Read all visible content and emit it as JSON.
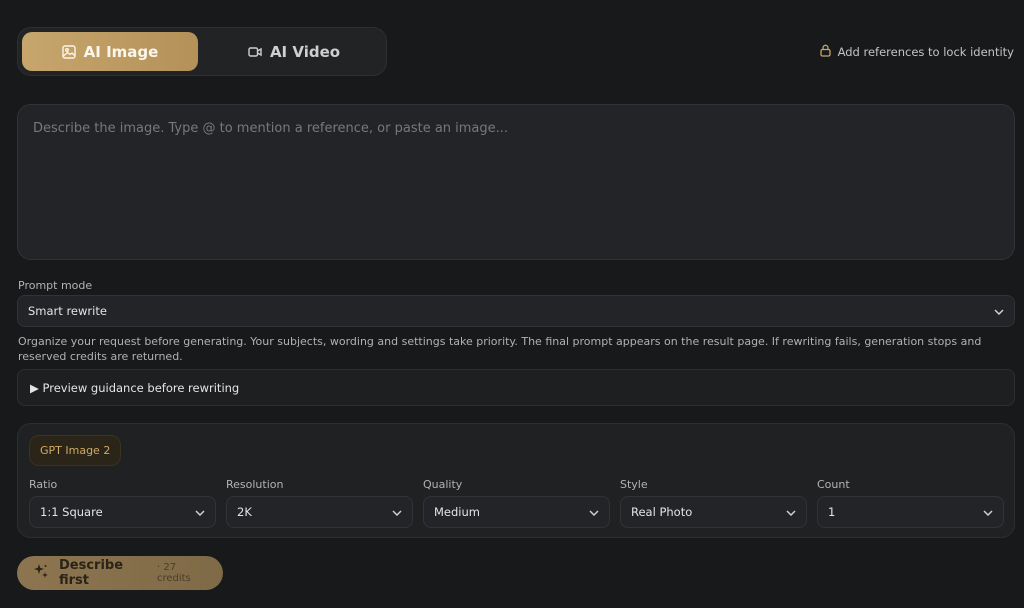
{
  "mode_switch": {
    "tabs": [
      {
        "label": "AI Image",
        "icon": "image-icon",
        "active": true
      },
      {
        "label": "AI Video",
        "icon": "video-icon",
        "active": false
      }
    ]
  },
  "lock_hint": {
    "label": "Add references to lock identity",
    "icon": "lock-icon"
  },
  "prompt": {
    "value": "",
    "placeholder": "Describe the image. Type @ to mention a reference, or paste an image..."
  },
  "prompt_mode": {
    "label": "Prompt mode",
    "value": "Smart rewrite",
    "helper": "Organize your request before generating. Your subjects, wording and settings take priority. The final prompt appears on the result page. If rewriting fails, generation stops and reserved credits are returned."
  },
  "preview": {
    "label": "▶ Preview guidance before rewriting"
  },
  "settings": {
    "model": "GPT Image 2",
    "fields": [
      {
        "label": "Ratio",
        "value": "1:1 Square"
      },
      {
        "label": "Resolution",
        "value": "2K"
      },
      {
        "label": "Quality",
        "value": "Medium"
      },
      {
        "label": "Style",
        "value": "Real Photo"
      },
      {
        "label": "Count",
        "value": "1"
      }
    ]
  },
  "generate": {
    "label": "Describe first",
    "credits": "· 27 credits",
    "icon": "sparkle-icon"
  },
  "colors": {
    "accent": "#c7a66d",
    "background": "#18191b",
    "surface": "#232427"
  }
}
